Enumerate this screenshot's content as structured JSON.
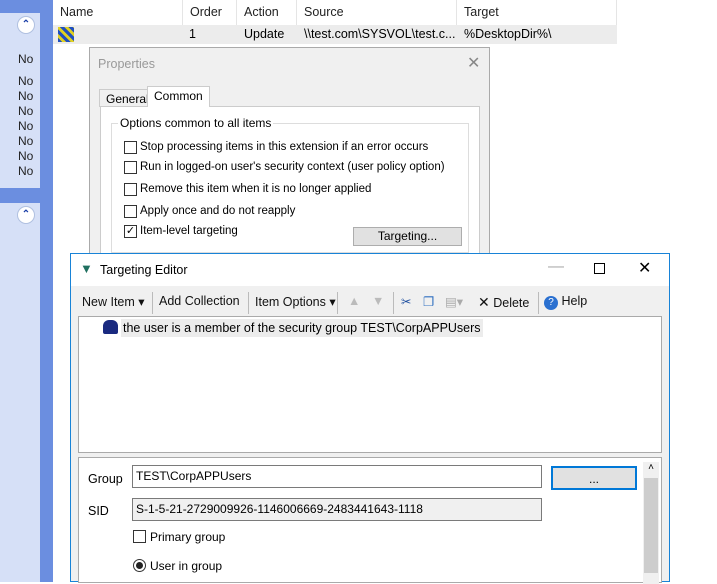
{
  "left_panel": {
    "values": [
      "No",
      "No",
      "No",
      "No",
      "No",
      "No",
      "No",
      "No"
    ],
    "collapse_icon": "double-chevron-up-icon"
  },
  "list": {
    "columns": [
      "Name",
      "Order",
      "Action",
      "Source",
      "Target"
    ],
    "rows": [
      {
        "name": "",
        "order": "1",
        "action": "Update",
        "source": "\\\\test.com\\SYSVOL\\test.c...",
        "target": "%DesktopDir%\\"
      }
    ]
  },
  "properties": {
    "title": "Properties",
    "tabs": [
      "General",
      "Common"
    ],
    "active_tab": "Common",
    "group_label": "Options common to all items",
    "options": [
      {
        "label": "Stop processing items in this extension if an error occurs",
        "checked": false
      },
      {
        "label": "Run in logged-on user's security context (user policy option)",
        "checked": false
      },
      {
        "label": "Remove this item when it is no longer applied",
        "checked": false
      },
      {
        "label": "Apply once and do not reapply",
        "checked": false
      },
      {
        "label": "Item-level targeting",
        "checked": true
      }
    ],
    "targeting_button": "Targeting..."
  },
  "targeting_editor": {
    "title": "Targeting Editor",
    "toolbar": {
      "new_item": "New Item",
      "add_collection": "Add Collection",
      "item_options": "Item Options",
      "delete": "Delete",
      "help": "Help"
    },
    "tree_item": "the user is a member of the security group TEST\\CorpAPPUsers",
    "group_label": "Group",
    "group_value": "TEST\\CorpAPPUsers",
    "browse_button": "...",
    "sid_label": "SID",
    "sid_value": "S-1-5-21-2729009926-1146006669-2483441643-1118",
    "primary_group_label": "Primary group",
    "primary_group_checked": false,
    "user_in_group_label": "User in group",
    "user_in_group_selected": true
  },
  "colors": {
    "accent": "#1883d7",
    "sidebar": "#6b8ee0"
  }
}
